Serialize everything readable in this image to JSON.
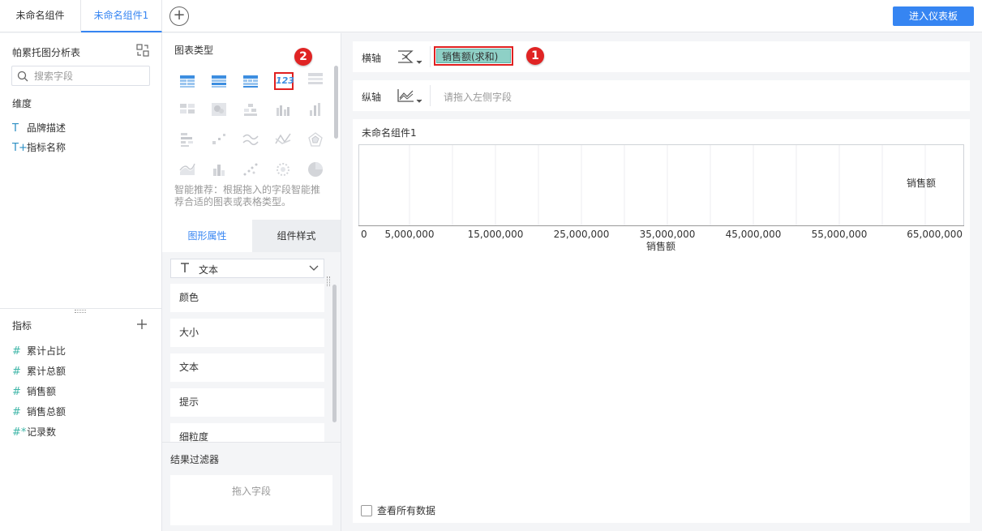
{
  "tabs": [
    {
      "label": "未命名组件",
      "active": false
    },
    {
      "label": "未命名组件1",
      "active": true
    }
  ],
  "add_tab_symbol": "+",
  "enter_dashboard_label": "进入仪表板",
  "left": {
    "table_name": "帕累托图分析表",
    "search_placeholder": "搜索字段",
    "dimension_label": "维度",
    "dimensions": [
      {
        "icon": "T",
        "name": "品牌描述"
      },
      {
        "icon": "T+",
        "name": "指标名称"
      }
    ],
    "measure_label": "指标",
    "measures": [
      {
        "icon": "#",
        "name": "累计占比"
      },
      {
        "icon": "#",
        "name": "累计总额"
      },
      {
        "icon": "#",
        "name": "销售额"
      },
      {
        "icon": "#",
        "name": "销售总额"
      },
      {
        "icon": "#*",
        "name": "记录数"
      }
    ]
  },
  "middle": {
    "chart_type_label": "图表类型",
    "selected_type_glyph": "123",
    "smart_recommend": "智能推荐：根据拖入的字段智能推荐合适的图表或表格类型。",
    "prop_tabs": [
      "图形属性",
      "组件样式"
    ],
    "text_select_value": "文本",
    "prop_items": [
      "颜色",
      "大小",
      "文本",
      "提示",
      "细粒度"
    ],
    "result_filter_label": "结果过滤器",
    "drop_field_label": "拖入字段"
  },
  "axes": {
    "x_label": "横轴",
    "x_field": "销售额(求和)",
    "y_label": "纵轴",
    "y_placeholder": "请拖入左侧字段"
  },
  "badges": [
    "1",
    "2"
  ],
  "canvas": {
    "title": "未命名组件1",
    "show_all_label": "查看所有数据"
  },
  "colors": {
    "accent": "#3685f2",
    "badge": "#e02424",
    "field_pill": "#8ed0c6",
    "icon_teal": "#3fb6a8"
  },
  "chart_data": {
    "type": "table",
    "series_label": "销售额",
    "xlabel": "销售额",
    "x_ticks": [
      "0",
      "5,000,000",
      "15,000,000",
      "25,000,000",
      "35,000,000",
      "45,000,000",
      "55,000,000",
      "65,000,000"
    ],
    "x_tick_values": [
      0,
      5000000,
      15000000,
      25000000,
      35000000,
      45000000,
      55000000,
      65000000
    ],
    "xlim": [
      0,
      65000000
    ]
  }
}
